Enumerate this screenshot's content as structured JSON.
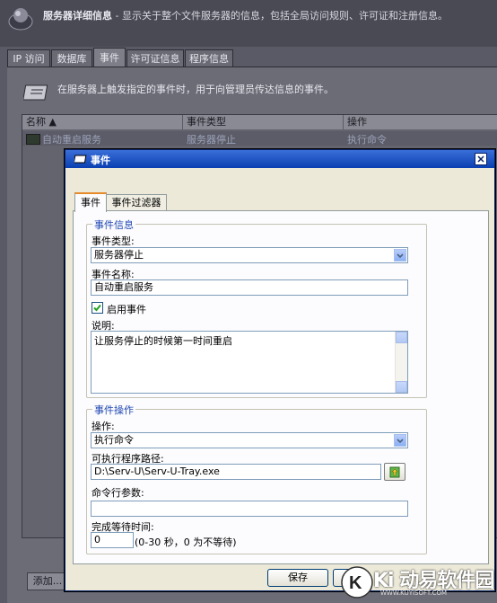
{
  "background": {
    "header": {
      "title": "服务器详细信息",
      "subtitle": " - 显示关于整个文件服务器的信息，包括全局访问规则、许可证和注册信息。"
    },
    "tabs": [
      {
        "label": "IP 访问"
      },
      {
        "label": "数据库"
      },
      {
        "label": "事件"
      },
      {
        "label": "许可证信息"
      },
      {
        "label": "程序信息"
      }
    ],
    "active_tab": "事件",
    "panel_description": "在服务器上触发指定的事件时，用于向管理员传达信息的事件。",
    "table": {
      "columns": [
        "名称",
        "事件类型",
        "操作"
      ],
      "rows": [
        {
          "name": "自动重启服务",
          "type": "服务器停止",
          "action": "执行命令"
        }
      ]
    },
    "add_button": "添加..."
  },
  "dialog": {
    "title": "事件",
    "tabs": [
      {
        "label": "事件"
      },
      {
        "label": "事件过滤器"
      }
    ],
    "event_info": {
      "legend": "事件信息",
      "event_type_label": "事件类型:",
      "event_type_value": "服务器停止",
      "event_name_label": "事件名称:",
      "event_name_value": "自动重启服务",
      "enable_label": "启用事件",
      "enabled": true,
      "description_label": "说明:",
      "description_value": "让服务停止的时候第一时间重启"
    },
    "event_action": {
      "legend": "事件操作",
      "action_label": "操作:",
      "action_value": "执行命令",
      "exe_path_label": "可执行程序路径:",
      "exe_path_value": "D:\\Serv-U\\Serv-U-Tray.exe",
      "args_label": "命令行参数:",
      "args_value": "",
      "wait_label": "完成等待时间:",
      "wait_value": "0",
      "wait_hint": "(0-30 秒，0 为不等待)"
    },
    "save_button": "保存"
  },
  "watermark": {
    "text": "Ki 动易软件园",
    "sub": "WWW.KUYISOFT.COM"
  },
  "colors": {
    "titlebar": "#0a3fb2",
    "legend": "#1f47b2",
    "dialog_bg": "#ece9d8",
    "tab_accent": "#e68b2c"
  }
}
